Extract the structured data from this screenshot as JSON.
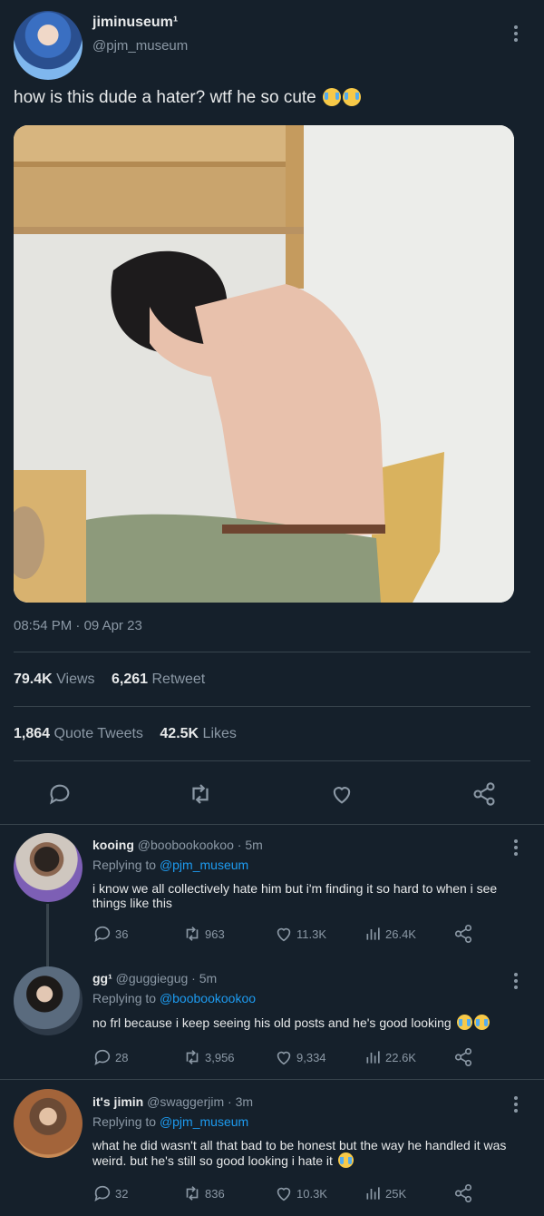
{
  "tweet": {
    "display_name": "jiminuseum¹",
    "handle": "@pjm_museum",
    "text": "how is this dude a hater? wtf he so cute",
    "time": "08:54 PM",
    "date": "09 Apr 23",
    "views_count": "79.4K",
    "views_label": "Views",
    "retweets_count": "6,261",
    "retweets_label": "Retweet",
    "quotes_count": "1,864",
    "quotes_label": "Quote Tweets",
    "likes_count": "42.5K",
    "likes_label": "Likes"
  },
  "replies": [
    {
      "display_name": "kooing",
      "handle": "@boobookookoo",
      "time": "5m",
      "replying_to_label": "Replying to",
      "replying_to": "@pjm_museum",
      "text": "i know we all collectively hate him but i'm finding it so hard to when i see things like this",
      "reply_count": "36",
      "retweet_count": "963",
      "like_count": "11.3K",
      "view_count": "26.4K"
    },
    {
      "display_name": "gg¹",
      "handle": "@guggiegug",
      "time": "5m",
      "replying_to_label": "Replying to",
      "replying_to": "@boobookookoo",
      "text": "no frl because i keep seeing his old posts and he's good looking",
      "reply_count": "28",
      "retweet_count": "3,956",
      "like_count": "9,334",
      "view_count": "22.6K"
    },
    {
      "display_name": "it's jimin",
      "handle": "@swaggerjim",
      "time": "3m",
      "replying_to_label": "Replying to",
      "replying_to": "@pjm_museum",
      "text": "what he did wasn't all that bad to be honest but the way he handled it was weird. but he's still so good looking i hate it",
      "reply_count": "32",
      "retweet_count": "836",
      "like_count": "10.3K",
      "view_count": "25K"
    }
  ],
  "icons": {
    "reply": "reply-icon",
    "retweet": "retweet-icon",
    "like": "heart-icon",
    "share": "share-icon",
    "views": "views-chart-icon",
    "more": "more-vertical-icon",
    "emoji": "loudly-crying-face-emoji"
  },
  "colors": {
    "background": "#15202b",
    "text": "#e7e9ea",
    "muted": "#8b98a5",
    "accent": "#1d9bf0",
    "divider": "#38444d"
  }
}
